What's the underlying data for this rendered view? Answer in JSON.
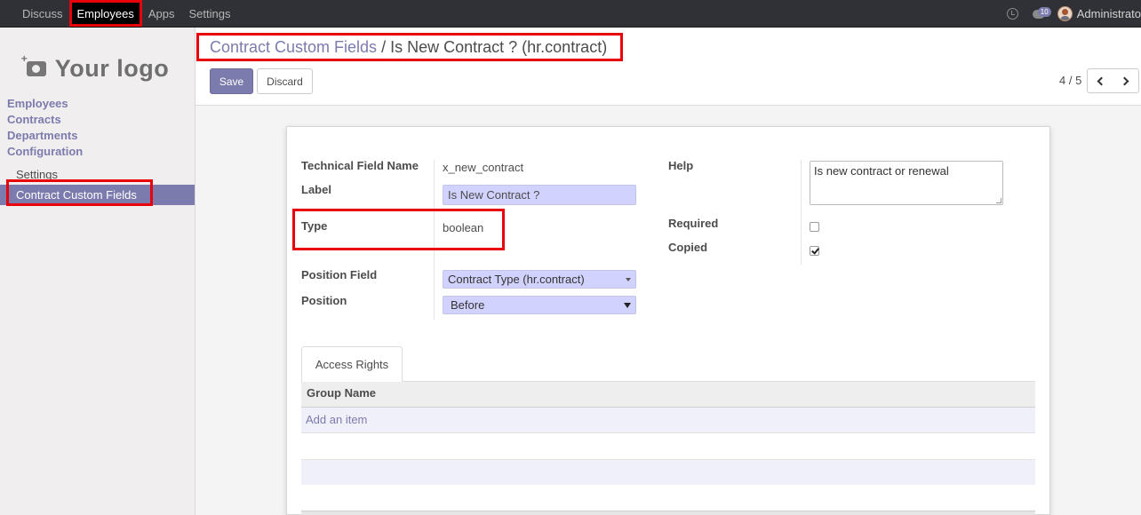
{
  "navbar": {
    "menu": [
      {
        "label": "Discuss",
        "active": false
      },
      {
        "label": "Employees",
        "active": true
      },
      {
        "label": "Apps",
        "active": false
      },
      {
        "label": "Settings",
        "active": false
      }
    ],
    "chat_count": "10",
    "user": "Administrato"
  },
  "sidebar": {
    "logo_text": "Your logo",
    "sections": [
      "Employees",
      "Contracts",
      "Departments",
      "Configuration"
    ],
    "sub_items": [
      {
        "label": "Settings",
        "active": false
      },
      {
        "label": "Contract Custom Fields",
        "active": true
      }
    ]
  },
  "breadcrumb": {
    "parent": "Contract Custom Fields",
    "separator": "/",
    "current": "Is New Contract ? (hr.contract)"
  },
  "toolbar": {
    "save_label": "Save",
    "discard_label": "Discard"
  },
  "pager": {
    "value": "4 / 5"
  },
  "form": {
    "technical_field_name": {
      "label": "Technical Field Name",
      "value": "x_new_contract"
    },
    "label": {
      "label": "Label",
      "value": "Is New Contract ?"
    },
    "type": {
      "label": "Type",
      "value": "boolean"
    },
    "position_field": {
      "label": "Position Field",
      "value": "Contract Type (hr.contract)"
    },
    "position": {
      "label": "Position",
      "value": "Before"
    },
    "help": {
      "label": "Help",
      "value": "Is new contract or renewal"
    },
    "required": {
      "label": "Required",
      "checked": false
    },
    "copied": {
      "label": "Copied",
      "checked": true
    }
  },
  "tabs": [
    {
      "label": "Access Rights"
    }
  ],
  "access_table": {
    "column": "Group Name",
    "add_item": "Add an item"
  },
  "colors": {
    "accent": "#7c7bad",
    "navbar": "#2f3136",
    "highlight": "#e8000b",
    "input_bg": "#d2d2ff"
  }
}
